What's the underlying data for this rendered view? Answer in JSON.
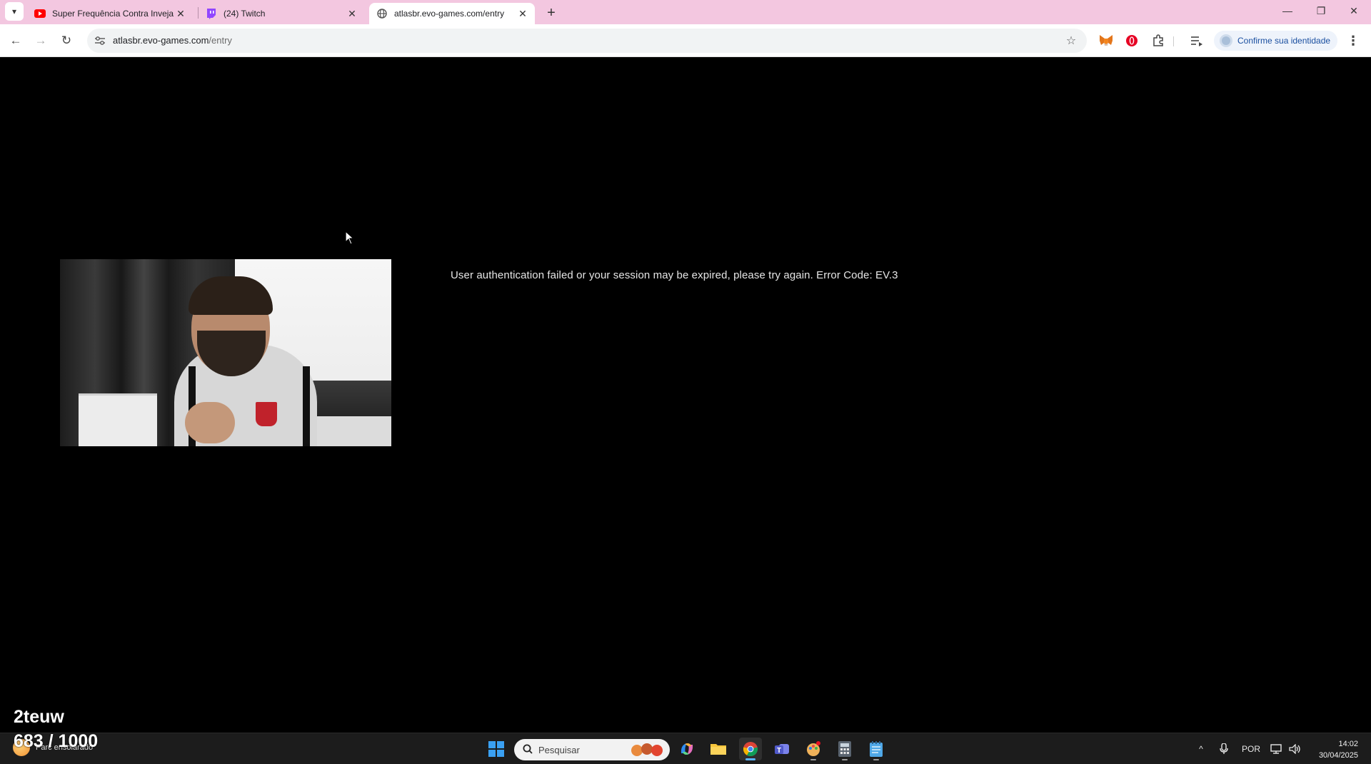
{
  "browser": {
    "tabs": [
      {
        "title": "Super Frequência Contra Inveja",
        "favicon": "youtube-icon",
        "close": "✕"
      },
      {
        "title": "(24) Twitch",
        "favicon": "twitch-icon",
        "close": "✕"
      },
      {
        "title": "atlasbr.evo-games.com/entry",
        "favicon": "globe-icon",
        "close": "✕",
        "active": true
      }
    ],
    "new_tab": "+",
    "window_controls": {
      "minimize": "—",
      "maximize": "❐",
      "close": "✕"
    },
    "nav": {
      "back": "←",
      "forward": "→",
      "reload": "↻"
    },
    "address": {
      "host": "atlasbr.evo-games.com",
      "path": "/entry"
    },
    "bookmark": "☆",
    "identity_label": "Confirme sua identidade",
    "menu": "⋮"
  },
  "page": {
    "error_message": "User authentication failed or your session may be expired, please try again. Error Code: EV.3"
  },
  "overlay": {
    "name": "2teuw",
    "counter": "683 / 1000"
  },
  "taskbar": {
    "weather": {
      "temp": "",
      "condition": "Parc ensolarado"
    },
    "search_placeholder": "Pesquisar",
    "tray": {
      "chevron": "^",
      "language": "POR"
    },
    "clock": {
      "time": "14:02",
      "date": "30/04/2025"
    }
  },
  "colors": {
    "tabstrip": "#f3c7e0",
    "page_background": "#000000",
    "taskbar": "#1c1c1c",
    "accent": "#1a73e8"
  }
}
